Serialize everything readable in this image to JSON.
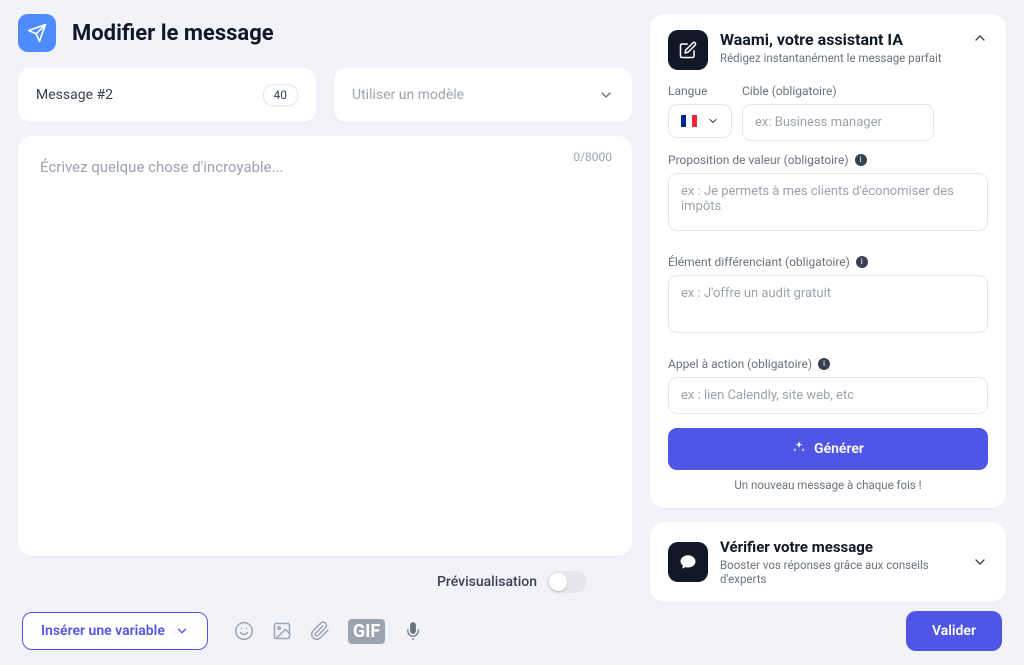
{
  "header": {
    "title": "Modifier le message"
  },
  "message_badge": {
    "label": "Message #2",
    "count": "40"
  },
  "template_select": {
    "placeholder": "Utiliser un modèle"
  },
  "editor": {
    "placeholder": "Écrivez quelque chose d'incroyable...",
    "counter": "0/8000"
  },
  "ai": {
    "title": "Waami, votre assistant IA",
    "subtitle": "Rédigez instantanément le message parfait",
    "langue_label": "Langue",
    "cible_label": "Cible (obligatoire)",
    "cible_placeholder": "ex: Business manager",
    "prop_label": "Proposition de valeur (obligatoire)",
    "prop_placeholder": "ex : Je permets à mes clients d'économiser des impôts",
    "diff_label": "Élément différenciant (obligatoire)",
    "diff_placeholder": "ex : J'offre un audit gratuit",
    "cta_label": "Appel à action (obligatoire)",
    "cta_placeholder": "ex : lien Calendly, site web, etc",
    "generate": "Générer",
    "note": "Un nouveau message à chaque fois !"
  },
  "verify": {
    "title": "Vérifier votre message",
    "subtitle": "Booster vos réponses grâce aux conseils d'experts"
  },
  "footer": {
    "preview": "Prévisualisation",
    "insert_variable": "Insérer une variable",
    "validate": "Valider"
  }
}
